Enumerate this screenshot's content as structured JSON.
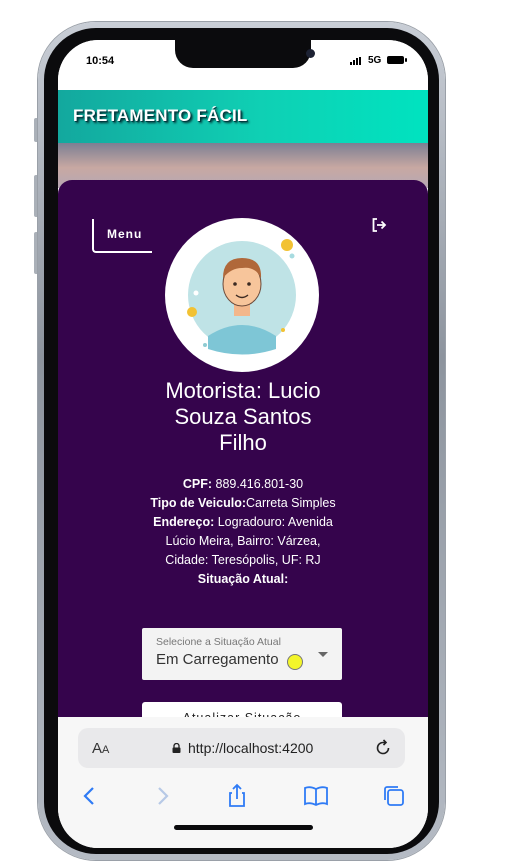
{
  "status_bar": {
    "time": "10:54",
    "network": "5G"
  },
  "app": {
    "title": "FRETAMENTO FÁCIL"
  },
  "profile": {
    "menu_label": "Menu",
    "name_line1": "Motorista: Lucio",
    "name_line2": "Souza Santos",
    "name_line3": "Filho",
    "cpf_label": "CPF:",
    "cpf_value": " 889.416.801-30",
    "vehicle_label": "Tipo de Veiculo:",
    "vehicle_value": "Carreta Simples",
    "address_label": "Endereço:",
    "address_value_part1": " Logradouro: Avenida",
    "address_value_part2": "Lúcio Meira, Bairro: Várzea,",
    "address_value_part3": "Cidade: Teresópolis, UF: RJ",
    "status_label": "Situação Atual:"
  },
  "status_select": {
    "label": "Selecione a Situação Atual",
    "value": "Em Carregamento",
    "indicator_color": "#f3f52a"
  },
  "update_button": {
    "label": "Atualizar Situação"
  },
  "browser": {
    "text_size_label_big": "A",
    "text_size_label_small": "A",
    "url": "http://localhost:4200"
  },
  "colors": {
    "card_bg": "#35044c",
    "header_start": "#13a89e",
    "header_end": "#00e3c0",
    "safari_icon": "#2f7bf5"
  }
}
